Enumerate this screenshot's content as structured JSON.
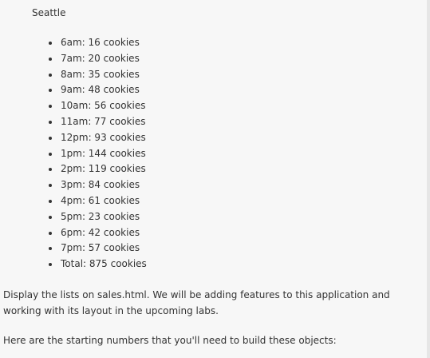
{
  "location": {
    "title": "Seattle",
    "hours": [
      "6am: 16 cookies",
      "7am: 20 cookies",
      "8am: 35 cookies",
      "9am: 48 cookies",
      "10am: 56 cookies",
      "11am: 77 cookies",
      "12pm: 93 cookies",
      "1pm: 144 cookies",
      "2pm: 119 cookies",
      "3pm: 84 cookies",
      "4pm: 61 cookies",
      "5pm: 23 cookies",
      "6pm: 42 cookies",
      "7pm: 57 cookies",
      "Total: 875 cookies"
    ]
  },
  "paragraphs": {
    "display_lists": "Display the lists on sales.html. We will be adding features to this application and working with its layout in the upcoming labs.",
    "starting_numbers": "Here are the starting numbers that you'll need to build these objects:"
  },
  "colors": {
    "background": "#f7f7f7",
    "text": "#333333"
  }
}
